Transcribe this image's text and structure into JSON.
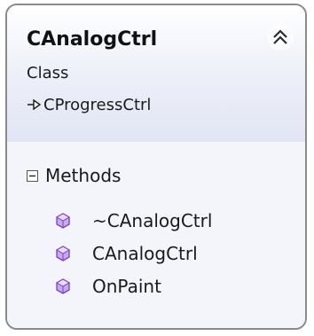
{
  "class_box": {
    "name": "CAnalogCtrl",
    "stereotype": "Class",
    "base_class": "CProgressCtrl",
    "collapse_icon": "double-chevron-up-icon",
    "inherit_icon": "inheritance-arrow-icon"
  },
  "methods_section": {
    "title": "Methods",
    "toggle_icon": "collapse-minus-icon",
    "member_icon": "method-cube-icon",
    "member_icon_color": "#8a4fc9",
    "members": [
      "~CAnalogCtrl",
      "CAnalogCtrl",
      "OnPaint"
    ]
  }
}
